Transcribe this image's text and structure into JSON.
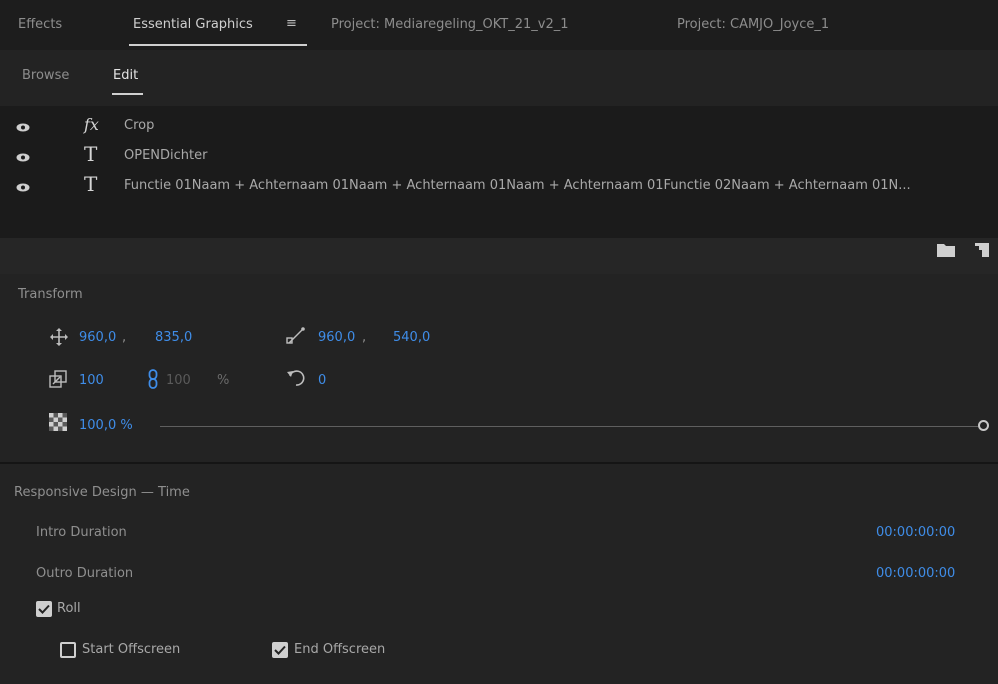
{
  "panel_tabs": [
    {
      "label": "Effects"
    },
    {
      "label": "Essential Graphics",
      "menu_icon": "hamburger-menu-icon"
    },
    {
      "label": "Project: Mediaregeling_OKT_21_v2_1"
    },
    {
      "label": "Project: CAMJO_Joyce_1"
    }
  ],
  "menu_glyph": "≡",
  "sub_tabs": {
    "browse": "Browse",
    "edit": "Edit",
    "active": "Edit"
  },
  "layers": [
    {
      "type_icon": "fx-icon",
      "type_glyph": "fx",
      "name": "Crop",
      "visible": true
    },
    {
      "type_icon": "text-layer-icon",
      "type_glyph": "T",
      "name": "OPENDichter",
      "visible": true
    },
    {
      "type_icon": "text-layer-icon",
      "type_glyph": "T",
      "name": "Functie 01Naam + Achternaam 01Naam + Achternaam 01Naam + Achternaam 01Functie 02Naam + Achternaam 01N...",
      "visible": true
    }
  ],
  "transform": {
    "title": "Transform",
    "position": {
      "x": "960,0",
      "sep": ",",
      "y": "835,0"
    },
    "anchor": {
      "x": "960,0",
      "sep": ",",
      "y": "540,0"
    },
    "scale": {
      "value": "100",
      "height": "100",
      "unit": "%"
    },
    "rotation": "0",
    "opacity": {
      "value": "100,0 %",
      "level_percent": 100
    }
  },
  "responsive": {
    "title": "Responsive Design — Time",
    "intro_label": "Intro Duration",
    "intro_value": "00:00:00:00",
    "outro_label": "Outro Duration",
    "outro_value": "00:00:00:00",
    "roll_label": "Roll",
    "roll_checked": true,
    "start_offscreen_label": "Start Offscreen",
    "start_offscreen_checked": false,
    "end_offscreen_label": "End Offscreen",
    "end_offscreen_checked": true
  },
  "colors": {
    "accent_value": "#3f8de8",
    "panel_bg": "#232323",
    "layer_bg": "#1b1b1b"
  }
}
